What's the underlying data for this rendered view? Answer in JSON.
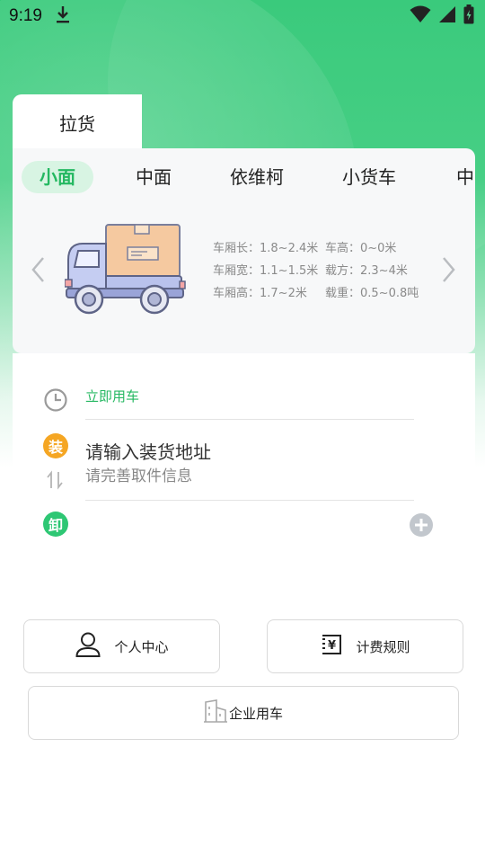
{
  "status_bar": {
    "time": "9:19",
    "icons": [
      "download-icon",
      "wifi-icon",
      "signal-icon",
      "battery-icon"
    ]
  },
  "tabs": [
    {
      "label": "拉货",
      "active": true
    }
  ],
  "vehicle_types": [
    {
      "label": "小面",
      "active": true
    },
    {
      "label": "中面",
      "active": false
    },
    {
      "label": "依维柯",
      "active": false
    },
    {
      "label": "小货车",
      "active": false
    },
    {
      "label": "中",
      "active": false
    }
  ],
  "vehicle_specs": {
    "length": "车厢长：1.8~2.4米",
    "width": "车厢宽：1.1~1.5米",
    "height_box": "车厢高：1.7~2米",
    "height": "车高：0~0米",
    "volume": "载方：2.3~4米",
    "load": "载重：0.5~0.8吨"
  },
  "order": {
    "time_label": "立即用车",
    "load_badge": "装",
    "load_title": "请输入装货地址",
    "load_subtitle": "请完善取件信息",
    "unload_badge": "卸"
  },
  "buttons": {
    "personal_center": "个人中心",
    "pricing_rules": "计费规则",
    "enterprise": "企业用车"
  },
  "colors": {
    "brand_green": "#26b862",
    "load_orange": "#f5a623",
    "unload_green": "#2ec774"
  }
}
